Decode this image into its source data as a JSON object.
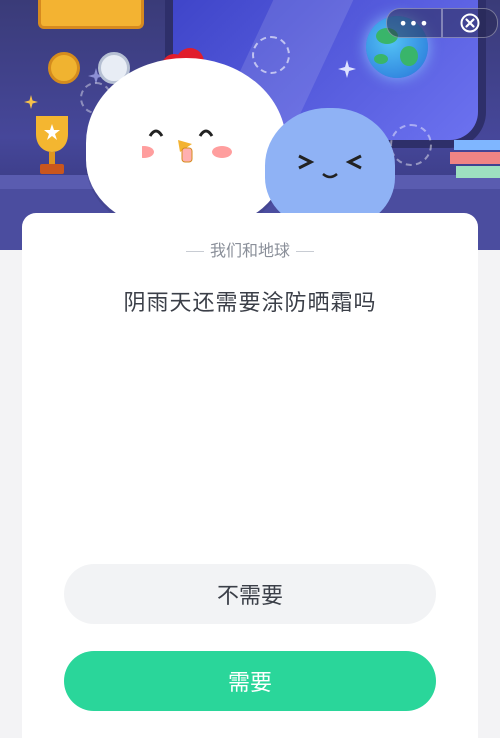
{
  "header": {
    "more_label": "•••",
    "close_icon": "close-icon"
  },
  "quiz": {
    "category": "我们和地球",
    "question": "阴雨天还需要涂防晒霜吗",
    "options": [
      "不需要",
      "需要"
    ]
  },
  "colors": {
    "primary": "#2ad69a",
    "secondary": "#f2f3f5",
    "scene_bg": "#46479a"
  }
}
